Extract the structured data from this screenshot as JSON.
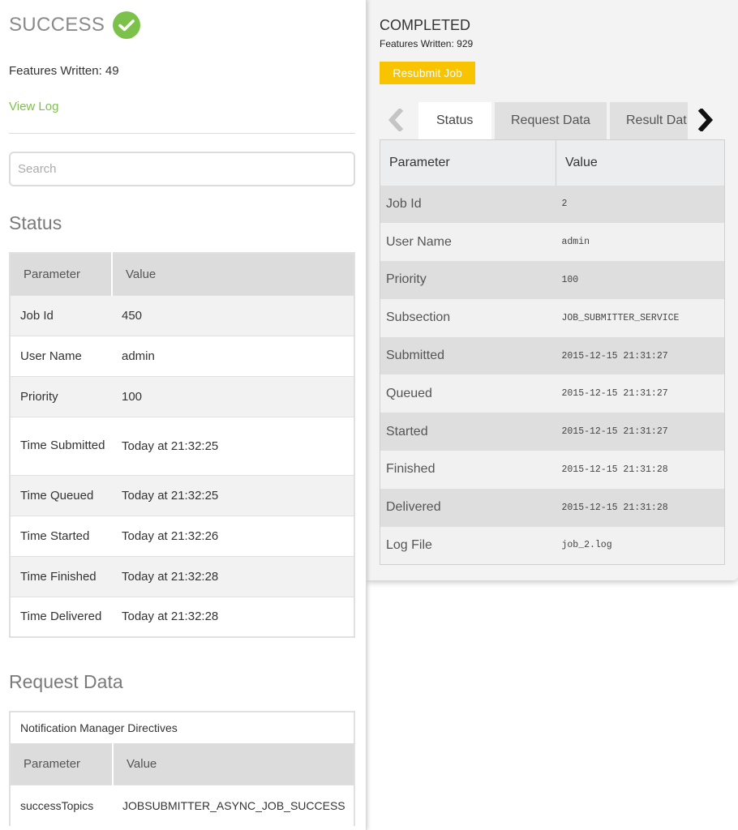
{
  "left_panel": {
    "status_title": "SUCCESS",
    "features_written": "Features Written: 49",
    "view_log": "View Log",
    "search_placeholder": "Search",
    "status_heading": "Status",
    "status_table": {
      "headers": [
        "Parameter",
        "Value"
      ],
      "rows": [
        [
          "Job Id",
          "450"
        ],
        [
          "User Name",
          "admin"
        ],
        [
          "Priority",
          "100"
        ],
        [
          "Time Submitted",
          "Today at 21:32:25"
        ],
        [
          "Time Queued",
          "Today at 21:32:25"
        ],
        [
          "Time Started",
          "Today at 21:32:26"
        ],
        [
          "Time Finished",
          "Today at 21:32:28"
        ],
        [
          "Time Delivered",
          "Today at 21:32:28"
        ]
      ]
    },
    "request_heading": "Request Data",
    "request_table": {
      "caption": "Notification Manager Directives",
      "headers": [
        "Parameter",
        "Value"
      ],
      "rows": [
        [
          "successTopics",
          "JOBSUBMITTER_ASYNC_JOB_SUCCESS"
        ]
      ]
    }
  },
  "right_panel": {
    "status_title": "COMPLETED",
    "features_written": "Features Written: 929",
    "resubmit_label": "Resubmit Job",
    "tabs": [
      "Status",
      "Request Data",
      "Result Dat"
    ],
    "table": {
      "headers": [
        "Parameter",
        "Value"
      ],
      "rows": [
        [
          "Job Id",
          "2"
        ],
        [
          "User Name",
          "admin"
        ],
        [
          "Priority",
          "100"
        ],
        [
          "Subsection",
          "JOB_SUBMITTER_SERVICE"
        ],
        [
          "Submitted",
          "2015-12-15 21:31:27"
        ],
        [
          "Queued",
          "2015-12-15 21:31:27"
        ],
        [
          "Started",
          "2015-12-15 21:31:27"
        ],
        [
          "Finished",
          "2015-12-15 21:31:28"
        ],
        [
          "Delivered",
          "2015-12-15 21:31:28"
        ],
        [
          "Log File",
          "job_2.log"
        ]
      ]
    }
  },
  "icons": {
    "success": "check-circle-icon",
    "tab_prev": "chevron-left-icon",
    "tab_next": "chevron-right-icon"
  },
  "colors": {
    "success_green": "#7cc24a",
    "resubmit_yellow": "#f8c300"
  }
}
